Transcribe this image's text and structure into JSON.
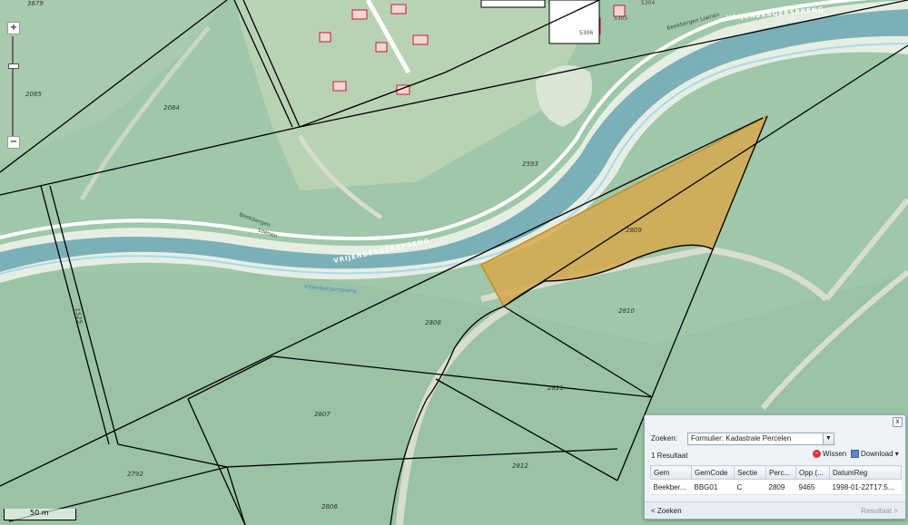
{
  "map": {
    "parcel_labels": [
      "2084",
      "2085",
      "2593",
      "2809",
      "2808",
      "2810",
      "2811",
      "2807",
      "2812",
      "2792",
      "2806",
      "3679",
      "5305",
      "5306",
      "5304",
      "1525"
    ],
    "street_labels": {
      "main": "VRIJENBERGERSPRENG",
      "north": "Beekbergen Loenen",
      "south_a": "Beekbergen",
      "south_b": "Loenen",
      "water": "Vrijenbergerspreng"
    },
    "house_numbers": [
      "5306",
      "5305",
      "5304"
    ],
    "colors": {
      "terrain": "#9fc7a9",
      "field": "#b7d3b7",
      "canal_water": "#7bb0b9",
      "canal_bank": "#e8efe4",
      "highlight_fill": "#d6a94f",
      "highlight_stroke": "#c98a1c",
      "parcel_line": "#000000"
    }
  },
  "zoom": {
    "in_label": "+",
    "out_label": "−"
  },
  "scale_bar": {
    "label": "50 m"
  },
  "results_panel": {
    "close_label": "x",
    "search_label": "Zoeken:",
    "search_value": "Formulier: Kadastrale Percelen",
    "result_count": "1 Resultaat",
    "clear_label": "Wissen",
    "download_label": "Download",
    "columns": [
      "Gem",
      "GemCode",
      "Sectie",
      "Perc...",
      "Opp (...",
      "DatumReg"
    ],
    "rows": [
      [
        "Beekber...",
        "BBG01",
        "C",
        "2809",
        "9465",
        "1998-01-22T17:5..."
      ]
    ],
    "prev_label": "< Zoeken",
    "next_label": "Resultaat >"
  }
}
